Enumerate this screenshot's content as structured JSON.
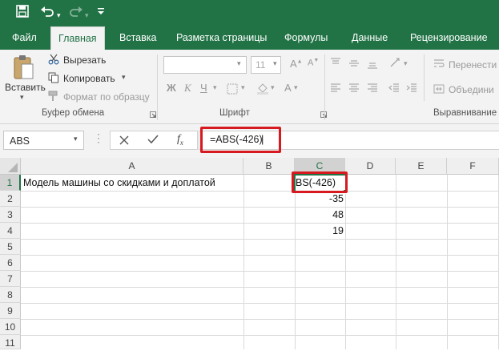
{
  "ribbon_tabs": [
    "Файл",
    "Главная",
    "Вставка",
    "Разметка страницы",
    "Формулы",
    "Данные",
    "Рецензирование"
  ],
  "clipboard": {
    "paste": "Вставить",
    "cut": "Вырезать",
    "copy": "Копировать",
    "format_painter": "Формат по образцу",
    "group_label": "Буфер обмена"
  },
  "font": {
    "size": "11",
    "group_label": "Шрифт"
  },
  "alignment": {
    "wrap": "Перенести",
    "merge": "Объедини",
    "group_label": "Выравнивание"
  },
  "formula_bar": {
    "name_box": "ABS",
    "formula": "=ABS(-426)"
  },
  "columns": [
    "A",
    "B",
    "C",
    "D",
    "E",
    "F"
  ],
  "rows": [
    "1",
    "2",
    "3",
    "4",
    "5",
    "6",
    "7",
    "8",
    "9",
    "10",
    "11"
  ],
  "cells": {
    "A1": "Модель машины со скидками и доплатой",
    "C1": "BS(-426)",
    "C2": "-35",
    "C3": "48",
    "C4": "19"
  },
  "colors": {
    "brand": "#217346",
    "highlight": "#d71920"
  }
}
